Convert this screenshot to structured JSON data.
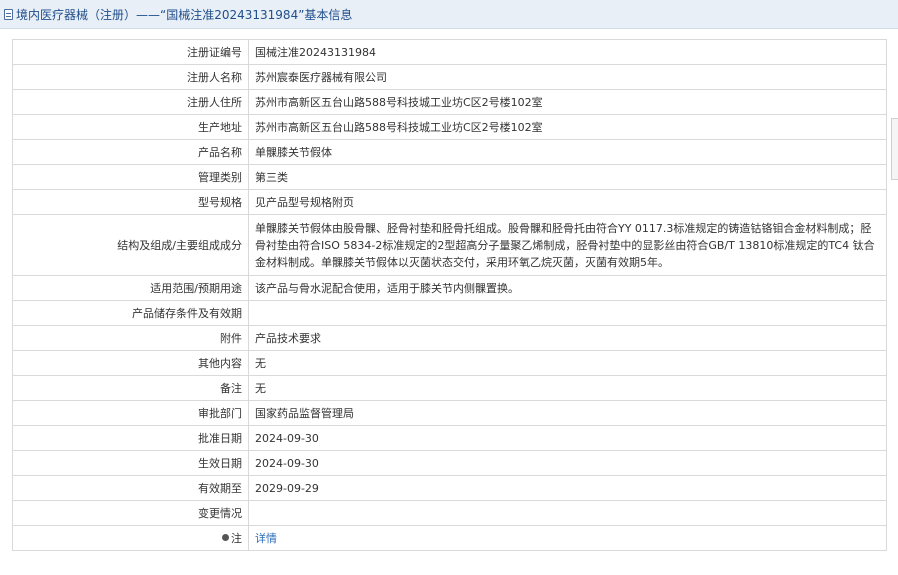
{
  "header": {
    "title": "境内医疗器械（注册）——“国械注准20243131984”基本信息"
  },
  "rows": [
    {
      "label": "注册证编号",
      "value": "国械注准20243131984"
    },
    {
      "label": "注册人名称",
      "value": "苏州宸泰医疗器械有限公司"
    },
    {
      "label": "注册人住所",
      "value": "苏州市高新区五台山路588号科技城工业坊C区2号楼102室"
    },
    {
      "label": "生产地址",
      "value": "苏州市高新区五台山路588号科技城工业坊C区2号楼102室"
    },
    {
      "label": "产品名称",
      "value": "单髁膝关节假体"
    },
    {
      "label": "管理类别",
      "value": "第三类"
    },
    {
      "label": "型号规格",
      "value": "见产品型号规格附页"
    },
    {
      "label": "结构及组成/主要组成成分",
      "value": "单髁膝关节假体由股骨髁、胫骨衬垫和胫骨托组成。股骨髁和胫骨托由符合YY 0117.3标准规定的铸造钴铬钼合金材料制成；胫骨衬垫由符合ISO 5834-2标准规定的2型超高分子量聚乙烯制成，胫骨衬垫中的显影丝由符合GB/T 13810标准规定的TC4 钛合金材料制成。单髁膝关节假体以灭菌状态交付，采用环氧乙烷灭菌，灭菌有效期5年。"
    },
    {
      "label": "适用范围/预期用途",
      "value": "该产品与骨水泥配合使用，适用于膝关节内侧髁置换。"
    },
    {
      "label": "产品储存条件及有效期",
      "value": ""
    },
    {
      "label": "附件",
      "value": "产品技术要求"
    },
    {
      "label": "其他内容",
      "value": "无"
    },
    {
      "label": "备注",
      "value": "无"
    },
    {
      "label": "审批部门",
      "value": "国家药品监督管理局"
    },
    {
      "label": "批准日期",
      "value": "2024-09-30"
    },
    {
      "label": "生效日期",
      "value": "2024-09-30"
    },
    {
      "label": "有效期至",
      "value": "2029-09-29"
    },
    {
      "label": "变更情况",
      "value": ""
    }
  ],
  "note_row": {
    "label": "注",
    "link": "详情"
  }
}
